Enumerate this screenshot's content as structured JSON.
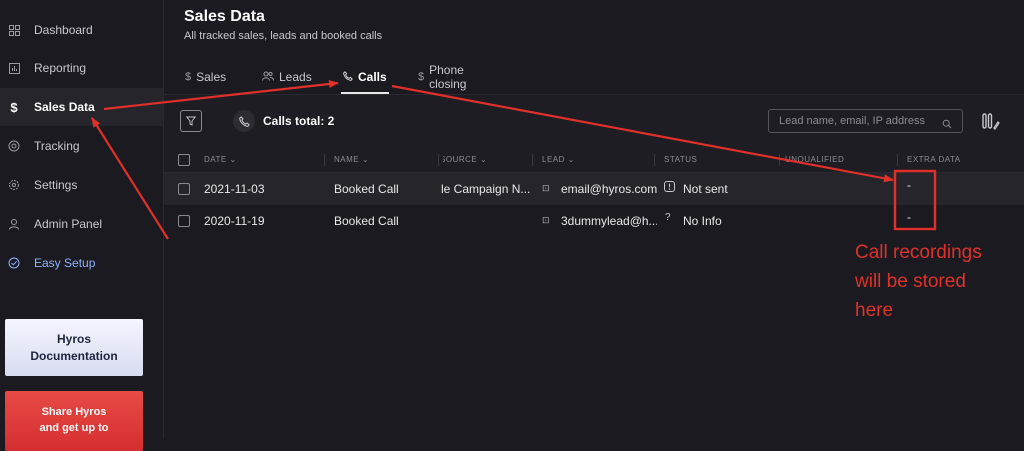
{
  "sidebar": {
    "items": [
      {
        "label": "Dashboard",
        "icon": "grid-icon"
      },
      {
        "label": "Reporting",
        "icon": "chart-icon"
      },
      {
        "label": "Sales Data",
        "icon": "dollar-icon"
      },
      {
        "label": "Tracking",
        "icon": "target-icon"
      },
      {
        "label": "Settings",
        "icon": "gear-icon"
      },
      {
        "label": "Admin Panel",
        "icon": "user-icon"
      },
      {
        "label": "Easy Setup",
        "icon": "check-circle-icon"
      }
    ],
    "active": "Sales Data",
    "doc_button": {
      "line1": "Hyros",
      "line2": "Documentation"
    },
    "share_button": {
      "line1": "Share Hyros",
      "line2": "and get up to"
    }
  },
  "page": {
    "title": "Sales Data",
    "subtitle": "All tracked sales, leads and booked calls"
  },
  "tabs": [
    {
      "label": "Sales",
      "icon": "$"
    },
    {
      "label": "Leads",
      "icon": "users-icon"
    },
    {
      "label": "Calls",
      "icon": "phone-icon"
    },
    {
      "label": "Phone closing",
      "icon": "$"
    }
  ],
  "active_tab": "Calls",
  "toolbar": {
    "calls_total": "Calls total: 2",
    "search_placeholder": "Lead name, email, IP address"
  },
  "table": {
    "columns": [
      "DATE",
      "NAME",
      "SOURCE",
      "LEAD",
      "STATUS",
      "UNQUALIFIED",
      "EXTRA DATA"
    ],
    "rows": [
      {
        "date": "2021-11-03",
        "name": "Booked Call",
        "source": "le Campaign N...",
        "lead": "email@hyros.com",
        "status": "Not sent",
        "unqualified": "",
        "extra": "-"
      },
      {
        "date": "2020-11-19",
        "name": "Booked Call",
        "source": "",
        "lead": "3dummylead@h...",
        "status": "No Info",
        "unqualified": "",
        "extra": "-"
      }
    ]
  },
  "annotation": {
    "line1": "Call recordings",
    "line2": "will be stored",
    "line3": "here",
    "color": "#e0302a"
  }
}
